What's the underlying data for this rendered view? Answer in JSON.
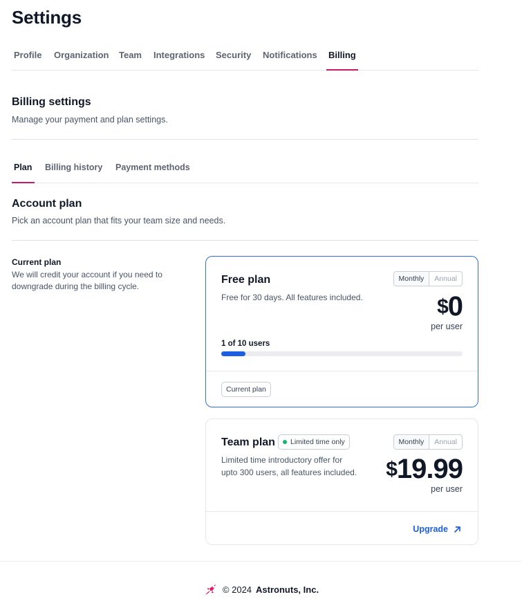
{
  "page": {
    "title": "Settings"
  },
  "main_tabs": [
    {
      "label": "Profile"
    },
    {
      "label": "Organization"
    },
    {
      "label": "Team"
    },
    {
      "label": "Integrations"
    },
    {
      "label": "Security"
    },
    {
      "label": "Notifications"
    },
    {
      "label": "Billing",
      "active": true
    }
  ],
  "billing": {
    "title": "Billing settings",
    "subtitle": "Manage your payment and plan settings."
  },
  "sub_tabs": [
    {
      "label": "Plan",
      "active": true
    },
    {
      "label": "Billing history"
    },
    {
      "label": "Payment methods"
    }
  ],
  "account_plan": {
    "title": "Account plan",
    "subtitle": "Pick an account plan that fits your team size and needs."
  },
  "current_plan": {
    "label": "Current plan",
    "description": "We will credit your account if you need to downgrade during the billing cycle."
  },
  "plans": {
    "free": {
      "name": "Free plan",
      "description": "Free for 30 days. All features included.",
      "toggle_monthly": "Monthly",
      "toggle_annual": "Annual",
      "currency": "$",
      "price": "0",
      "per": "per user",
      "users_label": "1 of 10 users",
      "users_used": 1,
      "users_total": 10,
      "chip": "Current plan"
    },
    "team": {
      "name": "Team plan",
      "badge": "Limited time only",
      "description": "Limited time introductory offer for upto 300 users, all features included.",
      "toggle_monthly": "Monthly",
      "toggle_annual": "Annual",
      "currency": "$",
      "price": "19.99",
      "per": "per user",
      "action": "Upgrade"
    }
  },
  "footer": {
    "copyright": "© 2024",
    "company": "Astronuts, Inc."
  },
  "colors": {
    "accent": "#c8186d",
    "primary": "#1d5fe0",
    "selected_border": "#2f6fe0",
    "badge_dot": "#12b76a"
  },
  "icons": {
    "upgrade": "arrow-up-right-icon",
    "logo": "astronuts-logo-icon"
  }
}
